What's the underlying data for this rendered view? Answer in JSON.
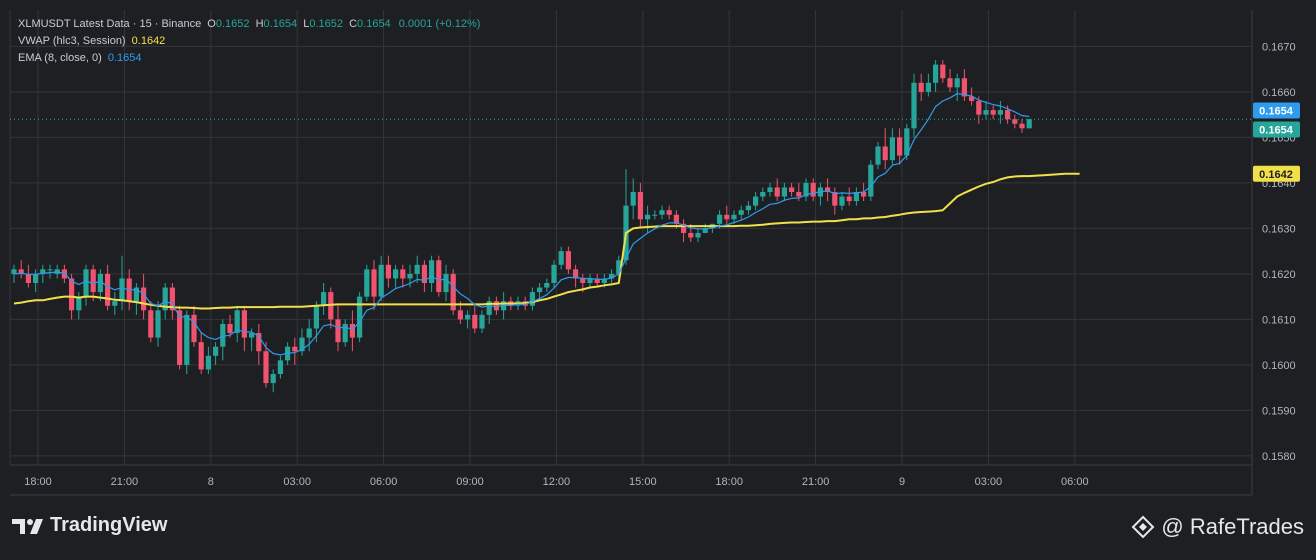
{
  "legend": {
    "title": "XLMUSDT Latest Data · 15 · Binance",
    "ohlc": [
      {
        "label": "O",
        "value": "0.1652"
      },
      {
        "label": "H",
        "value": "0.1654"
      },
      {
        "label": "L",
        "value": "0.1652"
      },
      {
        "label": "C",
        "value": "0.1654"
      }
    ],
    "change": "0.0001 (+0.12%)",
    "vwap_label": "VWAP (hlc3, Session)",
    "vwap_value": "0.1642",
    "ema_label": "EMA (8, close, 0)",
    "ema_value": "0.1654"
  },
  "colors": {
    "background": "#1e1f22",
    "grid": "#34363b",
    "up": "#26a69a",
    "down": "#ef5370",
    "vwap": "#f2e04b",
    "ema": "#2f9bef",
    "text": "#b2b5be"
  },
  "price_labels": {
    "ema": "0.1654",
    "last": "0.1654",
    "vwap": "0.1642"
  },
  "footer": {
    "brand": "TradingView",
    "author": "@ RafeTrades",
    "brand_icon": "tradingview-logo-icon",
    "author_icon": "binance-diamond-icon"
  },
  "chart_data": {
    "type": "candlestick",
    "symbol": "XLMUSDT",
    "interval": "15",
    "ylim": [
      0.1578,
      0.1678
    ],
    "y_ticks": [
      "0.1580",
      "0.1590",
      "0.1600",
      "0.1610",
      "0.1620",
      "0.1630",
      "0.1640",
      "0.1650",
      "0.1660",
      "0.1670"
    ],
    "x_ticks": [
      "18:00",
      "21:00",
      "8",
      "03:00",
      "06:00",
      "09:00",
      "12:00",
      "15:00",
      "18:00",
      "21:00",
      "9",
      "03:00",
      "06:00"
    ],
    "grid": true,
    "last_price": 0.1654,
    "candles": [
      [
        0.162,
        0.1622,
        0.1618,
        0.1621
      ],
      [
        0.1621,
        0.1623,
        0.1619,
        0.162
      ],
      [
        0.162,
        0.1622,
        0.1617,
        0.1618
      ],
      [
        0.1618,
        0.1621,
        0.1616,
        0.162
      ],
      [
        0.162,
        0.1622,
        0.1618,
        0.1621
      ],
      [
        0.1621,
        0.1622,
        0.1619,
        0.1621
      ],
      [
        0.162,
        0.1622,
        0.1619,
        0.1621
      ],
      [
        0.1621,
        0.1622,
        0.1618,
        0.1619
      ],
      [
        0.1619,
        0.162,
        0.161,
        0.1612
      ],
      [
        0.1612,
        0.1616,
        0.161,
        0.1615
      ],
      [
        0.1615,
        0.1622,
        0.1613,
        0.1621
      ],
      [
        0.1621,
        0.1622,
        0.1614,
        0.1616
      ],
      [
        0.1616,
        0.1621,
        0.1614,
        0.162
      ],
      [
        0.162,
        0.1622,
        0.1612,
        0.1613
      ],
      [
        0.1613,
        0.1616,
        0.1611,
        0.1614
      ],
      [
        0.1614,
        0.1624,
        0.1612,
        0.1619
      ],
      [
        0.1619,
        0.1621,
        0.1612,
        0.1614
      ],
      [
        0.1614,
        0.1618,
        0.1611,
        0.1617
      ],
      [
        0.1617,
        0.162,
        0.161,
        0.1612
      ],
      [
        0.1612,
        0.1614,
        0.1605,
        0.1606
      ],
      [
        0.1606,
        0.1614,
        0.1604,
        0.1612
      ],
      [
        0.1612,
        0.1618,
        0.161,
        0.1617
      ],
      [
        0.1617,
        0.1618,
        0.161,
        0.1612
      ],
      [
        0.1612,
        0.1613,
        0.1599,
        0.16
      ],
      [
        0.16,
        0.1612,
        0.1598,
        0.1611
      ],
      [
        0.1611,
        0.1613,
        0.1604,
        0.1605
      ],
      [
        0.1605,
        0.1607,
        0.1598,
        0.1599
      ],
      [
        0.1599,
        0.1604,
        0.1598,
        0.1602
      ],
      [
        0.1602,
        0.1605,
        0.16,
        0.1604
      ],
      [
        0.1604,
        0.161,
        0.1601,
        0.1609
      ],
      [
        0.1609,
        0.1611,
        0.1606,
        0.1607
      ],
      [
        0.1607,
        0.1613,
        0.1605,
        0.1612
      ],
      [
        0.1612,
        0.1613,
        0.1603,
        0.1606
      ],
      [
        0.1606,
        0.1608,
        0.1603,
        0.1607
      ],
      [
        0.1607,
        0.1609,
        0.16,
        0.1603
      ],
      [
        0.1603,
        0.1605,
        0.1595,
        0.1596
      ],
      [
        0.1596,
        0.1599,
        0.1594,
        0.1598
      ],
      [
        0.1598,
        0.1602,
        0.1597,
        0.1601
      ],
      [
        0.1601,
        0.1605,
        0.16,
        0.1604
      ],
      [
        0.1604,
        0.1606,
        0.16,
        0.1603
      ],
      [
        0.1603,
        0.1608,
        0.1602,
        0.1606
      ],
      [
        0.1606,
        0.161,
        0.1603,
        0.1608
      ],
      [
        0.1608,
        0.1614,
        0.1605,
        0.1613
      ],
      [
        0.1613,
        0.1618,
        0.1611,
        0.1616
      ],
      [
        0.1616,
        0.1617,
        0.1608,
        0.161
      ],
      [
        0.161,
        0.1613,
        0.1603,
        0.1605
      ],
      [
        0.1605,
        0.161,
        0.1604,
        0.1609
      ],
      [
        0.1609,
        0.1612,
        0.1603,
        0.1606
      ],
      [
        0.1606,
        0.1616,
        0.1605,
        0.1615
      ],
      [
        0.1615,
        0.1622,
        0.1614,
        0.1621
      ],
      [
        0.1621,
        0.1623,
        0.1612,
        0.1615
      ],
      [
        0.1615,
        0.1624,
        0.1614,
        0.1622
      ],
      [
        0.1622,
        0.1624,
        0.1617,
        0.1619
      ],
      [
        0.1619,
        0.1622,
        0.1617,
        0.1621
      ],
      [
        0.1621,
        0.1622,
        0.1617,
        0.1619
      ],
      [
        0.1619,
        0.1622,
        0.1617,
        0.162
      ],
      [
        0.162,
        0.1624,
        0.1618,
        0.1622
      ],
      [
        0.1622,
        0.1623,
        0.1616,
        0.1618
      ],
      [
        0.1618,
        0.1624,
        0.1616,
        0.1623
      ],
      [
        0.1623,
        0.1624,
        0.1615,
        0.1616
      ],
      [
        0.1616,
        0.1622,
        0.1614,
        0.162
      ],
      [
        0.162,
        0.1621,
        0.1611,
        0.1612
      ],
      [
        0.1612,
        0.1614,
        0.1609,
        0.161
      ],
      [
        0.161,
        0.1612,
        0.1608,
        0.1611
      ],
      [
        0.1611,
        0.1613,
        0.1607,
        0.1608
      ],
      [
        0.1608,
        0.1612,
        0.1607,
        0.1611
      ],
      [
        0.1611,
        0.1615,
        0.1609,
        0.1614
      ],
      [
        0.1614,
        0.1615,
        0.1611,
        0.1612
      ],
      [
        0.1612,
        0.1616,
        0.161,
        0.1614
      ],
      [
        0.1614,
        0.1615,
        0.1612,
        0.1613
      ],
      [
        0.1613,
        0.1615,
        0.1612,
        0.1614
      ],
      [
        0.1614,
        0.1615,
        0.1612,
        0.1613
      ],
      [
        0.1613,
        0.1617,
        0.1612,
        0.1616
      ],
      [
        0.1616,
        0.1618,
        0.1614,
        0.1617
      ],
      [
        0.1617,
        0.1619,
        0.1616,
        0.1618
      ],
      [
        0.1618,
        0.1623,
        0.1617,
        0.1622
      ],
      [
        0.1622,
        0.1626,
        0.1621,
        0.1625
      ],
      [
        0.1625,
        0.1626,
        0.162,
        0.1621
      ],
      [
        0.1621,
        0.1622,
        0.1617,
        0.1619
      ],
      [
        0.1619,
        0.162,
        0.1616,
        0.1618
      ],
      [
        0.1618,
        0.162,
        0.1617,
        0.1619
      ],
      [
        0.1619,
        0.162,
        0.1617,
        0.1618
      ],
      [
        0.1618,
        0.162,
        0.1617,
        0.1619
      ],
      [
        0.1619,
        0.1621,
        0.1618,
        0.162
      ],
      [
        0.162,
        0.1624,
        0.1619,
        0.1623
      ],
      [
        0.1623,
        0.1643,
        0.1622,
        0.1635
      ],
      [
        0.1635,
        0.1641,
        0.1632,
        0.1638
      ],
      [
        0.1638,
        0.164,
        0.163,
        0.1632
      ],
      [
        0.1632,
        0.1635,
        0.1629,
        0.1633
      ],
      [
        0.1633,
        0.1634,
        0.1632,
        0.1633
      ],
      [
        0.1633,
        0.1635,
        0.1632,
        0.1634
      ],
      [
        0.1634,
        0.1635,
        0.1632,
        0.1633
      ],
      [
        0.1633,
        0.1634,
        0.163,
        0.1631
      ],
      [
        0.1631,
        0.1632,
        0.1627,
        0.1629
      ],
      [
        0.1629,
        0.1631,
        0.1627,
        0.1628
      ],
      [
        0.1628,
        0.163,
        0.1627,
        0.1629
      ],
      [
        0.1629,
        0.1631,
        0.1629,
        0.163
      ],
      [
        0.163,
        0.1631,
        0.1629,
        0.1631
      ],
      [
        0.1631,
        0.1634,
        0.163,
        0.1633
      ],
      [
        0.1633,
        0.1635,
        0.1631,
        0.1632
      ],
      [
        0.1632,
        0.1634,
        0.1631,
        0.1633
      ],
      [
        0.1633,
        0.1635,
        0.1632,
        0.1634
      ],
      [
        0.1634,
        0.1636,
        0.1633,
        0.1635
      ],
      [
        0.1635,
        0.1638,
        0.1634,
        0.1637
      ],
      [
        0.1637,
        0.1639,
        0.1636,
        0.1638
      ],
      [
        0.1638,
        0.164,
        0.1637,
        0.1639
      ],
      [
        0.1639,
        0.1641,
        0.1636,
        0.1637
      ],
      [
        0.1637,
        0.164,
        0.1636,
        0.1639
      ],
      [
        0.1639,
        0.164,
        0.1637,
        0.1638
      ],
      [
        0.1638,
        0.164,
        0.1636,
        0.1637
      ],
      [
        0.1637,
        0.1641,
        0.1636,
        0.164
      ],
      [
        0.164,
        0.1641,
        0.1636,
        0.1637
      ],
      [
        0.1637,
        0.164,
        0.1635,
        0.1639
      ],
      [
        0.1639,
        0.1641,
        0.1636,
        0.1638
      ],
      [
        0.1638,
        0.1639,
        0.1633,
        0.1635
      ],
      [
        0.1635,
        0.1638,
        0.1634,
        0.1637
      ],
      [
        0.1637,
        0.1639,
        0.1635,
        0.1636
      ],
      [
        0.1636,
        0.1639,
        0.1635,
        0.1638
      ],
      [
        0.1638,
        0.164,
        0.1636,
        0.1637
      ],
      [
        0.1637,
        0.1645,
        0.1636,
        0.1644
      ],
      [
        0.1644,
        0.1649,
        0.1643,
        0.1648
      ],
      [
        0.1648,
        0.1652,
        0.1643,
        0.1645
      ],
      [
        0.1645,
        0.1652,
        0.1644,
        0.165
      ],
      [
        0.165,
        0.1652,
        0.1644,
        0.1646
      ],
      [
        0.1646,
        0.1653,
        0.1645,
        0.1652
      ],
      [
        0.1652,
        0.1664,
        0.165,
        0.1662
      ],
      [
        0.1662,
        0.1664,
        0.1658,
        0.166
      ],
      [
        0.166,
        0.1664,
        0.1659,
        0.1662
      ],
      [
        0.1662,
        0.1667,
        0.166,
        0.1666
      ],
      [
        0.1666,
        0.1667,
        0.1662,
        0.1663
      ],
      [
        0.1663,
        0.1665,
        0.166,
        0.1661
      ],
      [
        0.1661,
        0.1664,
        0.1658,
        0.1663
      ],
      [
        0.1663,
        0.1665,
        0.1658,
        0.1659
      ],
      [
        0.1659,
        0.1661,
        0.1657,
        0.1658
      ],
      [
        0.1658,
        0.1659,
        0.1653,
        0.1655
      ],
      [
        0.1655,
        0.1658,
        0.1654,
        0.1656
      ],
      [
        0.1656,
        0.1657,
        0.1654,
        0.1655
      ],
      [
        0.1655,
        0.1658,
        0.1653,
        0.1656
      ],
      [
        0.1656,
        0.1657,
        0.1653,
        0.1654
      ],
      [
        0.1654,
        0.1655,
        0.1652,
        0.1653
      ],
      [
        0.1653,
        0.1654,
        0.1651,
        0.1652
      ],
      [
        0.1652,
        0.1654,
        0.1652,
        0.1654
      ]
    ],
    "series": [
      {
        "name": "VWAP (hlc3, Session)",
        "role": "vwap",
        "values": [
          0.16135,
          0.16137,
          0.1614,
          0.16142,
          0.16142,
          0.16145,
          0.16148,
          0.1615,
          0.1615,
          0.16148,
          0.1615,
          0.1615,
          0.16148,
          0.16146,
          0.16143,
          0.16142,
          0.1614,
          0.16138,
          0.16135,
          0.16132,
          0.1613,
          0.16128,
          0.16127,
          0.16126,
          0.16126,
          0.16125,
          0.16124,
          0.16124,
          0.16125,
          0.16126,
          0.16126,
          0.16127,
          0.16127,
          0.16127,
          0.16127,
          0.16127,
          0.16127,
          0.16128,
          0.16128,
          0.16128,
          0.16128,
          0.16129,
          0.1613,
          0.16131,
          0.16132,
          0.16133,
          0.16133,
          0.16133,
          0.16133,
          0.16133,
          0.16133,
          0.16133,
          0.16133,
          0.16133,
          0.16133,
          0.16133,
          0.16133,
          0.16133,
          0.16133,
          0.16133,
          0.16133,
          0.16133,
          0.16133,
          0.16133,
          0.16133,
          0.16133,
          0.16134,
          0.16134,
          0.16135,
          0.16135,
          0.16135,
          0.16136,
          0.16138,
          0.16142,
          0.16145,
          0.1615,
          0.16155,
          0.1616,
          0.16163,
          0.16166,
          0.1617,
          0.16172,
          0.16175,
          0.16177,
          0.1618,
          0.1629,
          0.163,
          0.16302,
          0.16303,
          0.16304,
          0.16305,
          0.16305,
          0.16305,
          0.16305,
          0.16305,
          0.16305,
          0.16305,
          0.16305,
          0.16305,
          0.16305,
          0.16305,
          0.16306,
          0.16306,
          0.16307,
          0.16308,
          0.1631,
          0.16311,
          0.16312,
          0.16313,
          0.16313,
          0.16314,
          0.16315,
          0.16315,
          0.16316,
          0.16316,
          0.16318,
          0.1632,
          0.1632,
          0.16322,
          0.16322,
          0.16324,
          0.16325,
          0.16328,
          0.1633,
          0.16333,
          0.16335,
          0.16336,
          0.16337,
          0.16338,
          0.1634,
          0.16355,
          0.1637,
          0.16378,
          0.16385,
          0.16392,
          0.16398,
          0.16402,
          0.16408,
          0.16412,
          0.16414,
          0.16415,
          0.16415,
          0.16416,
          0.16417,
          0.16418,
          0.16419,
          0.1642,
          0.1642,
          0.1642
        ]
      },
      {
        "name": "EMA (8, close, 0)",
        "role": "ema",
        "values": [
          0.162,
          0.16201,
          0.16199,
          0.16199,
          0.16201,
          0.16203,
          0.16204,
          0.16202,
          0.16184,
          0.16177,
          0.16184,
          0.16179,
          0.16184,
          0.16172,
          0.16165,
          0.1617,
          0.16164,
          0.16166,
          0.16156,
          0.16135,
          0.1613,
          0.16139,
          0.16135,
          0.16105,
          0.16106,
          0.16094,
          0.16071,
          0.1606,
          0.16056,
          0.16063,
          0.16065,
          0.16077,
          0.16073,
          0.16072,
          0.16063,
          0.16038,
          0.16025,
          0.16022,
          0.16026,
          0.16027,
          0.16034,
          0.16045,
          0.16064,
          0.16086,
          0.16089,
          0.16081,
          0.16083,
          0.16078,
          0.16094,
          0.1612,
          0.16126,
          0.16147,
          0.16157,
          0.16168,
          0.16173,
          0.16179,
          0.16188,
          0.16186,
          0.16194,
          0.16186,
          0.16189,
          0.16172,
          0.16156,
          0.16146,
          0.16132,
          0.16127,
          0.1613,
          0.16128,
          0.16131,
          0.16131,
          0.16133,
          0.16133,
          0.16139,
          0.16146,
          0.16154,
          0.16169,
          0.16187,
          0.16192,
          0.16192,
          0.1619,
          0.1619,
          0.16188,
          0.16188,
          0.16191,
          0.162,
          0.16234,
          0.16266,
          0.16278,
          0.1629,
          0.16299,
          0.16307,
          0.16312,
          0.16312,
          0.16307,
          0.16301,
          0.16299,
          0.16299,
          0.16301,
          0.16305,
          0.16308,
          0.16313,
          0.16318,
          0.16325,
          0.16335,
          0.16343,
          0.16353,
          0.16355,
          0.16362,
          0.16366,
          0.16367,
          0.16374,
          0.16378,
          0.1638,
          0.16383,
          0.16376,
          0.16378,
          0.16377,
          0.16378,
          0.1638,
          0.16392,
          0.16413,
          0.16421,
          0.16439,
          0.16443,
          0.1646,
          0.16495,
          0.16517,
          0.1654,
          0.16568,
          0.1658,
          0.16587,
          0.16596,
          0.16594,
          0.16591,
          0.16582,
          0.16577,
          0.16572,
          0.16569,
          0.16563,
          0.16556,
          0.16548,
          0.16546
        ]
      }
    ]
  }
}
